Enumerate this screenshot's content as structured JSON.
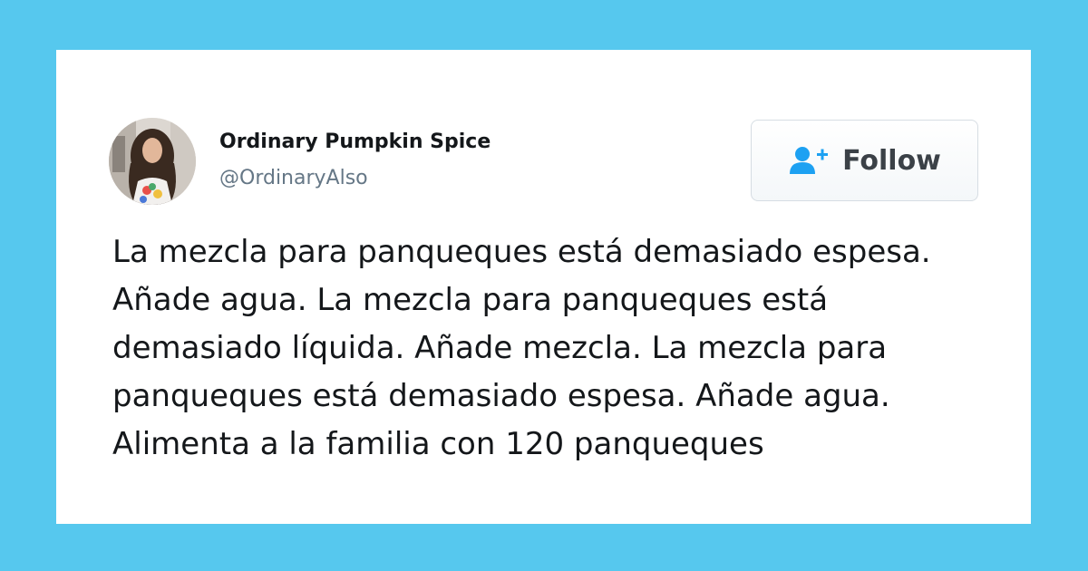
{
  "theme": {
    "background": "#56c8ee",
    "card": "#ffffff",
    "text": "#14171a",
    "muted": "#657786",
    "follow_icon": "#1da1f2"
  },
  "author": {
    "display_name": "Ordinary Pumpkin Spice",
    "handle": "@OrdinaryAlso",
    "avatar_icon": "profile-photo"
  },
  "follow_button": {
    "label": "Follow",
    "icon": "add-user-icon"
  },
  "tweet": {
    "lines": [
      "La mezcla para panqueques está demasiado espesa.",
      "Añade agua. La mezcla para panqueques está",
      "demasiado líquida. Añade mezcla. La mezcla para",
      "panqueques está demasiado espesa. Añade agua.",
      "Alimenta a la familia con 120 panqueques"
    ]
  }
}
